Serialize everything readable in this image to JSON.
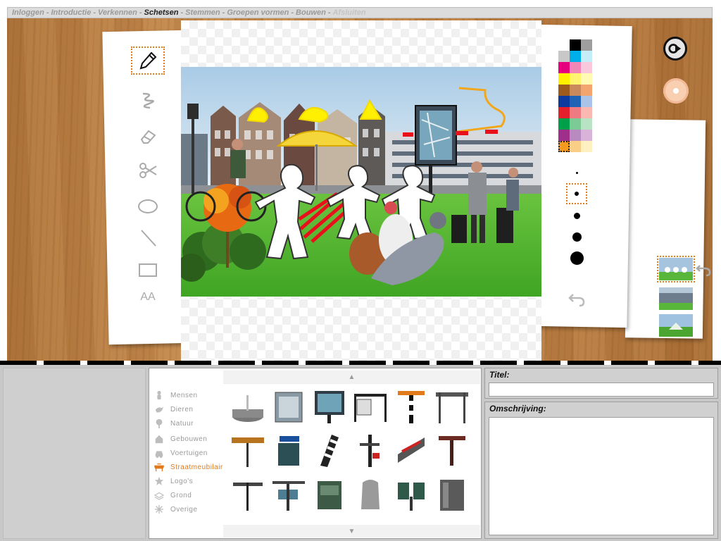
{
  "nav": {
    "steps": [
      {
        "label": "Inloggen",
        "state": "done"
      },
      {
        "label": "Introductie",
        "state": "done"
      },
      {
        "label": "Verkennen",
        "state": "done"
      },
      {
        "label": "Schetsen",
        "state": "active"
      },
      {
        "label": "Stemmen",
        "state": "todo"
      },
      {
        "label": "Groepen vormen",
        "state": "todo"
      },
      {
        "label": "Bouwen",
        "state": "todo"
      },
      {
        "label": "Afsluiten",
        "state": "disabled"
      }
    ],
    "separator": "-"
  },
  "tools": [
    {
      "name": "pencil-tool",
      "icon": "pencil-icon",
      "selected": true
    },
    {
      "name": "brush-tool",
      "icon": "squiggle-icon",
      "selected": false
    },
    {
      "name": "eraser-tool",
      "icon": "eraser-icon",
      "selected": false
    },
    {
      "name": "scissors-tool",
      "icon": "scissors-icon",
      "selected": false
    },
    {
      "name": "ellipse-tool",
      "icon": "ellipse-icon",
      "selected": false
    },
    {
      "name": "line-tool",
      "icon": "line-icon",
      "selected": false
    },
    {
      "name": "rectangle-tool",
      "icon": "rectangle-icon",
      "selected": false
    },
    {
      "name": "text-tool",
      "icon": "text-icon",
      "label": "AA",
      "selected": false
    }
  ],
  "palette": {
    "colors": [
      "#ffffff",
      "#000000",
      "#9e9e9e",
      "#c8c8c8",
      "#00aee8",
      "#c5ecf9",
      "#e6007e",
      "#f287b7",
      "#f8c9dd",
      "#fff100",
      "#fff46f",
      "#fffab4",
      "#9c5b1c",
      "#c9895a",
      "#f3a56f",
      "#0d3a9e",
      "#1e63b5",
      "#aac3e6",
      "#e3202b",
      "#ef7b82",
      "#f9b9b2",
      "#00a04b",
      "#7ccb96",
      "#b8e3c4",
      "#9f2f8b",
      "#b98ac0",
      "#d9b3d8",
      "#f39a1f",
      "#f9cf87",
      "#fff0c2"
    ],
    "selected_index": 27
  },
  "brush_sizes": [
    {
      "size": 3,
      "selected": false
    },
    {
      "size": 6,
      "selected": true
    },
    {
      "size": 9,
      "selected": false
    },
    {
      "size": 13,
      "selected": false
    },
    {
      "size": 19,
      "selected": false
    }
  ],
  "thumbnails": [
    {
      "name": "scene-thumbnail-1",
      "selected": true
    },
    {
      "name": "scene-thumbnail-2",
      "selected": false
    },
    {
      "name": "scene-thumbnail-3",
      "selected": false
    }
  ],
  "library": {
    "categories": [
      {
        "label": "Mensen",
        "icon": "person-icon",
        "active": false
      },
      {
        "label": "Dieren",
        "icon": "bird-icon",
        "active": false
      },
      {
        "label": "Natuur",
        "icon": "tree-icon",
        "active": false
      },
      {
        "label": "Gebouwen",
        "icon": "house-icon",
        "active": false
      },
      {
        "label": "Voertuigen",
        "icon": "car-icon",
        "active": false
      },
      {
        "label": "Straatmeubilair",
        "icon": "bench-icon",
        "active": true
      },
      {
        "label": "Logo's",
        "icon": "star-icon",
        "active": false
      },
      {
        "label": "Grond",
        "icon": "ground-icon",
        "active": false
      },
      {
        "label": "Overige",
        "icon": "asterisk-icon",
        "active": false
      }
    ],
    "objects": [
      "fountain",
      "info-board",
      "map-board",
      "bus-shelter",
      "barrier-pole",
      "sign-frame",
      "direction-sign",
      "street-name-sign",
      "striped-bollard",
      "lamp-post",
      "billboard",
      "table-stand",
      "pointer-sign",
      "signpost",
      "trash-bin",
      "public-urinal",
      "double-bin",
      "container"
    ]
  },
  "meta": {
    "title_label": "Titel:",
    "title_value": "",
    "description_label": "Omschrijving:",
    "description_value": ""
  },
  "colors": {
    "accent": "#e07a1a",
    "nav_bg": "#dcdcdc",
    "panel_bg": "#c8c8c8"
  }
}
